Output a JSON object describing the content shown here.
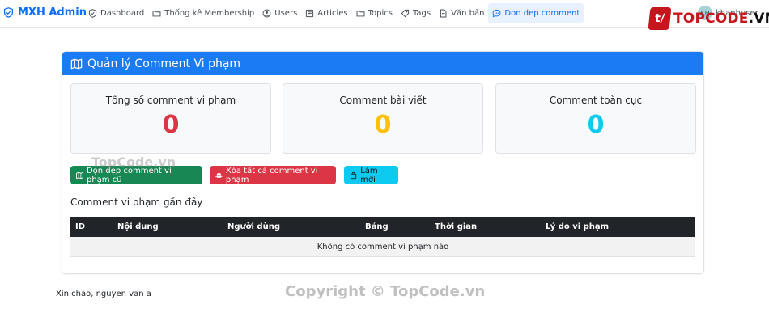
{
  "navbar": {
    "brand": "MXH Admin",
    "items": [
      {
        "label": "Dashboard",
        "icon": "speedometer-icon"
      },
      {
        "label": "Thống kê Membership",
        "icon": "folder-icon"
      },
      {
        "label": "Users",
        "icon": "person-circle-icon"
      },
      {
        "label": "Articles",
        "icon": "newspaper-icon"
      },
      {
        "label": "Topics",
        "icon": "folder-icon"
      },
      {
        "label": "Tags",
        "icon": "tag-icon"
      },
      {
        "label": "Văn bản",
        "icon": "file-text-icon"
      },
      {
        "label": "Don dep comment",
        "icon": "chat-dots-icon",
        "active": true
      }
    ],
    "user": {
      "initials": "KH",
      "name": "khanhuser"
    }
  },
  "watermark_logo": {
    "mark": "t/",
    "text_red": "TOPCODE",
    "text_dark": ".VN"
  },
  "card": {
    "title": "Quản lý Comment Vi phạm",
    "stats": [
      {
        "label": "Tổng số comment vi phạm",
        "value": "0",
        "color": "#dc3545"
      },
      {
        "label": "Comment bài viết",
        "value": "0",
        "color": "#ffc107"
      },
      {
        "label": "Comment toàn cục",
        "value": "0",
        "color": "#0dcaf0"
      }
    ],
    "buttons": [
      {
        "label": "Dọn dẹp comment vi phạm cũ",
        "color": "#198754"
      },
      {
        "label": "Xóa tất cả comment vi phạm",
        "color": "#dc3545"
      },
      {
        "label": "Làm mới",
        "color": "#0dcaf0"
      }
    ],
    "section_title": "Comment vi phạm gần đây",
    "table": {
      "columns": [
        "ID",
        "Nội dung",
        "Người dùng",
        "Bảng",
        "Thời gian",
        "Lý do vi phạm"
      ],
      "empty_message": "Không có comment vi phạm nào"
    }
  },
  "footer": {
    "greeting": "Xin chào, nguyen van a"
  },
  "watermarks": [
    "TopCode.vn",
    "Copyright © TopCode.vn"
  ],
  "colors": {
    "primary": "#0d6efd",
    "header": "#1a7bf5",
    "success": "#198754",
    "danger": "#dc3545",
    "warning": "#ffc107",
    "info": "#0dcaf0",
    "dark": "#212529"
  }
}
